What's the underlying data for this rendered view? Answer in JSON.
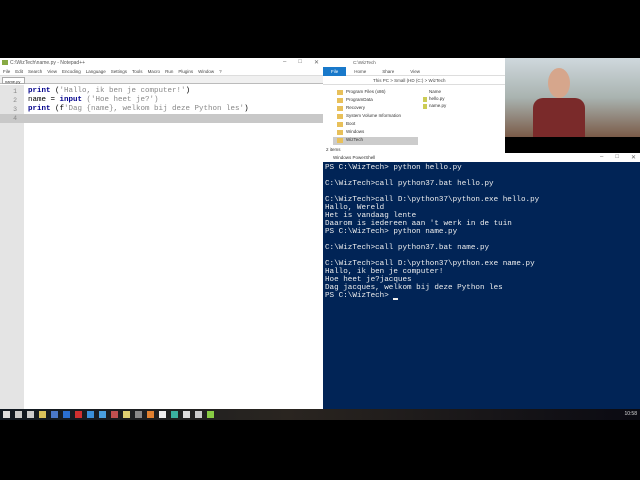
{
  "notepad": {
    "title": "C:\\WizTech\\name.py - Notepad++",
    "menu": [
      "File",
      "Edit",
      "Search",
      "View",
      "Encoding",
      "Language",
      "Settings",
      "Tools",
      "Macro",
      "Run",
      "Plugins",
      "Window",
      "?"
    ],
    "tab": "name.py",
    "lines": [
      {
        "n": "1",
        "kw": "print",
        "rest": " (",
        "str": "'Hallo, ik ben je computer!'",
        "end": ")"
      },
      {
        "n": "2",
        "kw": "",
        "rest": "name = ",
        "kw2": "input",
        "str": " ('Hoe heet je?')",
        "end": ""
      },
      {
        "n": "3",
        "kw": "print",
        "rest": " (f",
        "str": "'Dag {name}, welkom bij deze Python les'",
        "end": ")"
      },
      {
        "n": "4"
      }
    ]
  },
  "explorer": {
    "title": "C:\\WizTech",
    "ribbon": [
      "File",
      "Home",
      "Share",
      "View"
    ],
    "address": "This PC > Small (HD (C:) > WizTech",
    "nav": [
      "Program Files (x86)",
      "ProgramData",
      "Recovery",
      "System Volume Information",
      "Boot",
      "Windows",
      "WizTech"
    ],
    "column": "Name",
    "files": [
      "hello.py",
      "name.py"
    ],
    "status": "2 items"
  },
  "powershell": {
    "title": "Windows PowerShell",
    "lines": [
      "PS C:\\WizTech> python hello.py",
      "",
      "C:\\WizTech>call python37.bat hello.py",
      "",
      "C:\\WizTech>call D:\\python37\\python.exe hello.py",
      "Hallo, Wereld",
      "Het is vandaag lente",
      "Daarom is iedereen aan 't werk in de tuin",
      "PS C:\\WizTech> python name.py",
      "",
      "C:\\WizTech>call python37.bat name.py",
      "",
      "C:\\WizTech>call D:\\python37\\python.exe name.py",
      "Hallo, ik ben je computer!",
      "Hoe heet je?jacques",
      "Dag jacques, welkom bij deze Python les"
    ],
    "prompt": "PS C:\\WizTech> "
  },
  "taskbar": {
    "clock": "10:58",
    "icon_colors": [
      "#ddd",
      "#ccc",
      "#ccc",
      "#d9c25a",
      "#4a78c8",
      "#2a6fd0",
      "#d03030",
      "#3a8fd9",
      "#4aa0e0",
      "#c05050",
      "#e0d070",
      "#888",
      "#e08030",
      "#eee",
      "#3ab0a0",
      "#ddd",
      "#ccc",
      "#8c4"
    ]
  }
}
